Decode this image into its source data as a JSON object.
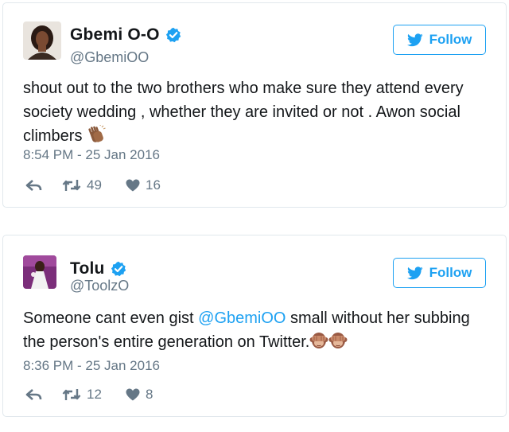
{
  "tweets": [
    {
      "display_name": "Gbemi O-O",
      "handle": "@GbemiOO",
      "follow_label": "Follow",
      "text_before": "shout out to the two brothers who make sure they attend every society wedding , whether they are invited or not . Awon social climbers ",
      "mention": "",
      "text_after": "",
      "emojis": [
        "clapping-hands"
      ],
      "timestamp": "8:54 PM - 25 Jan 2016",
      "retweets": "49",
      "likes": "16"
    },
    {
      "display_name": "Tolu",
      "handle": "@ToolzO",
      "follow_label": "Follow",
      "text_before": "Someone cant even gist ",
      "mention": "@GbemiOO",
      "text_after": " small without her subbing the person's entire generation on Twitter.",
      "emojis": [
        "see-no-evil-monkey",
        "see-no-evil-monkey"
      ],
      "timestamp": "8:36 PM - 25 Jan 2016",
      "retweets": "12",
      "likes": "8"
    }
  ],
  "colors": {
    "brand_blue": "#1da1f2",
    "secondary_text": "#657786",
    "border": "#e1e8ed"
  },
  "icons": [
    "verified-icon",
    "twitter-bird-icon",
    "reply-icon",
    "retweet-icon",
    "heart-icon"
  ]
}
